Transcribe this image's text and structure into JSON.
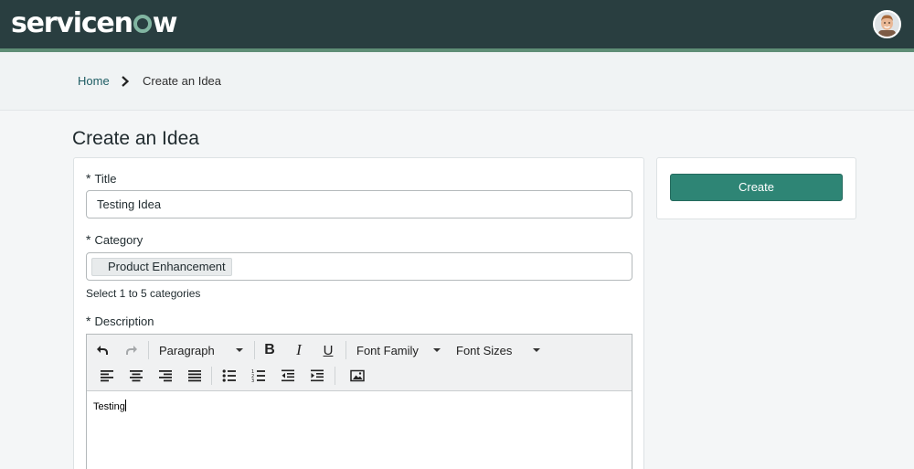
{
  "header": {
    "logo_pre": "servicen",
    "logo_post": "w",
    "avatar_icon": "user-avatar-icon"
  },
  "breadcrumb": {
    "home": "Home",
    "current": "Create an Idea"
  },
  "page": {
    "title": "Create an Idea"
  },
  "form": {
    "required_mark": "*",
    "title_label": "Title",
    "title_value": "Testing Idea",
    "category_label": "Category",
    "category_tag": "Product Enhancement",
    "category_hint": "Select 1 to 5 categories",
    "description_label": "Description",
    "description_content": "Testing"
  },
  "editor": {
    "block_format": "Paragraph",
    "font_family": "Font Family",
    "font_size": "Font Sizes",
    "icons": [
      "undo-icon",
      "redo-icon",
      "bold-icon",
      "italic-icon",
      "underline-icon",
      "align-left-icon",
      "align-center-icon",
      "align-right-icon",
      "align-justify-icon",
      "bullet-list-icon",
      "numbered-list-icon",
      "outdent-icon",
      "indent-icon",
      "insert-image-icon"
    ]
  },
  "actions": {
    "create_label": "Create"
  },
  "colors": {
    "header_bg": "#293e40",
    "header_accent": "#5f8e76",
    "logo_accent": "#81b5a1",
    "primary_button": "#2e8575",
    "link": "#1d5c63"
  }
}
